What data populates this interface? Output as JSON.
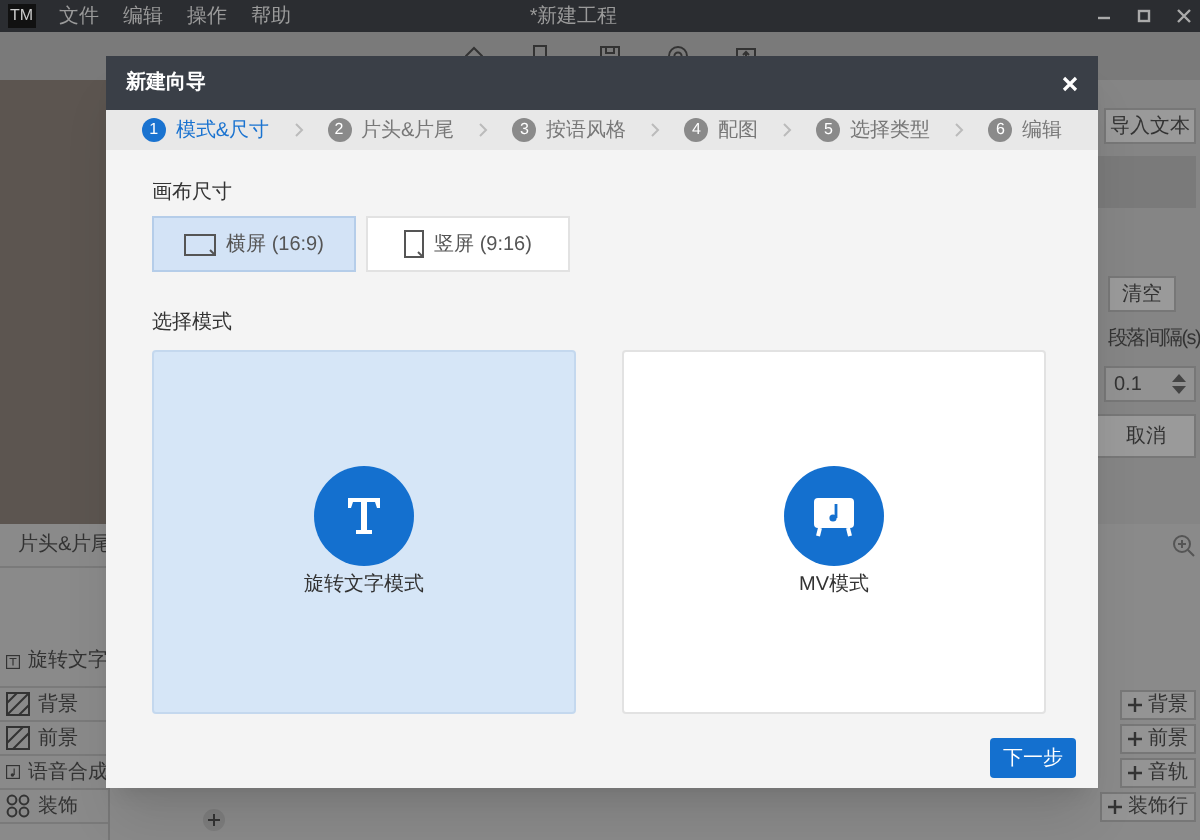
{
  "app": {
    "logo": "TM",
    "menu": [
      "文件",
      "编辑",
      "操作",
      "帮助"
    ],
    "title": "*新建工程"
  },
  "right_panel": {
    "import_button": "导入文本",
    "clear_button": "清空",
    "interval_label": "段落间隔(s)",
    "interval_value": "0.1",
    "cancel_button": "取消"
  },
  "timeline": {
    "intro_outro": "片头&片尾",
    "tracks": [
      {
        "kind": "text",
        "label": "旋转文字"
      },
      {
        "kind": "background",
        "label": "背景"
      },
      {
        "kind": "foreground",
        "label": "前景"
      },
      {
        "kind": "voice",
        "label": "语音合成"
      },
      {
        "kind": "decor",
        "label": "装饰"
      }
    ],
    "add_buttons": [
      "背景",
      "前景",
      "音轨",
      "装饰行"
    ]
  },
  "dialog": {
    "title": "新建向导",
    "steps": [
      {
        "number": "1",
        "label": "模式&尺寸",
        "selected": true
      },
      {
        "number": "2",
        "label": "片头&片尾",
        "selected": false
      },
      {
        "number": "3",
        "label": "按语风格",
        "selected": false
      },
      {
        "number": "4",
        "label": "配图",
        "selected": false
      },
      {
        "number": "5",
        "label": "选择类型",
        "selected": false
      },
      {
        "number": "6",
        "label": "编辑",
        "selected": false
      }
    ],
    "canvas_size": {
      "label": "画布尺寸",
      "options": [
        {
          "kind": "landscape",
          "label": "横屏 (16:9)",
          "selected": true
        },
        {
          "kind": "portrait",
          "label": "竖屏 (9:16)",
          "selected": false
        }
      ]
    },
    "mode": {
      "label": "选择模式",
      "options": [
        {
          "kind": "text",
          "label": "旋转文字模式",
          "selected": true
        },
        {
          "kind": "mv",
          "label": "MV模式",
          "selected": false
        }
      ]
    },
    "next_button": "下一步"
  }
}
